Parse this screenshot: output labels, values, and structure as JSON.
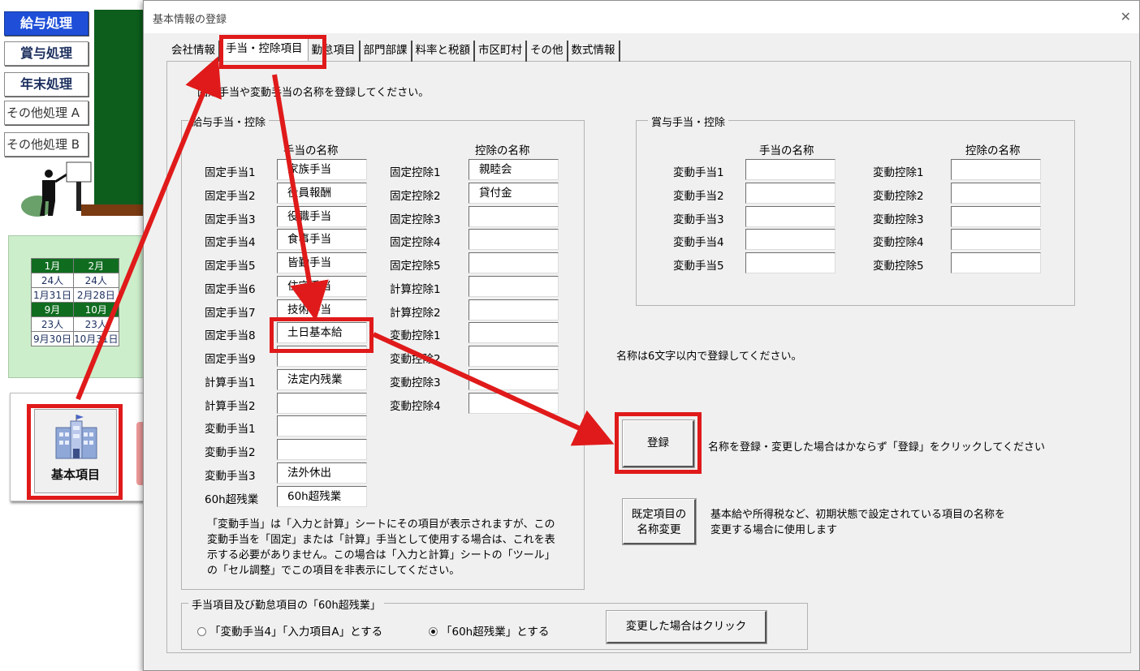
{
  "sheet": {
    "side_buttons": [
      "給与処理",
      "賞与処理",
      "年末処理",
      "その他処理 A",
      "その他処理 B"
    ],
    "calendar": [
      [
        "1月",
        "2月"
      ],
      [
        "24人",
        "24人"
      ],
      [
        "1月31日",
        "2月28日"
      ],
      [
        "9月",
        "10月"
      ],
      [
        "23人",
        "23人"
      ],
      [
        "9月30日",
        "10月31日"
      ]
    ],
    "kihon_label": "基本項目"
  },
  "dialog": {
    "title": "基本情報の登録",
    "close_glyph": "✕",
    "tabs": [
      {
        "label": "会社情報",
        "selected": false
      },
      {
        "label": "手当・控除項目",
        "selected": true
      },
      {
        "label": "勤怠項目",
        "selected": false
      },
      {
        "label": "部門部課",
        "selected": false
      },
      {
        "label": "料率と税額",
        "selected": false
      },
      {
        "label": "市区町村",
        "selected": false
      },
      {
        "label": "その他",
        "selected": false
      },
      {
        "label": "数式情報",
        "selected": false
      }
    ],
    "instruction": "固定手当や変動手当の名称を登録してください。",
    "kyuyo": {
      "legend": "給与手当・控除",
      "allowance_header": "手当の名称",
      "deduction_header": "控除の名称",
      "allowances": [
        {
          "label": "固定手当1",
          "value": "家族手当"
        },
        {
          "label": "固定手当2",
          "value": "役員報酬"
        },
        {
          "label": "固定手当3",
          "value": "役職手当"
        },
        {
          "label": "固定手当4",
          "value": "食事手当"
        },
        {
          "label": "固定手当5",
          "value": "皆勤手当"
        },
        {
          "label": "固定手当6",
          "value": "住宅手当"
        },
        {
          "label": "固定手当7",
          "value": "技術手当"
        },
        {
          "label": "固定手当8",
          "value": "土日基本給"
        },
        {
          "label": "固定手当9",
          "value": ""
        },
        {
          "label": "計算手当1",
          "value": "法定内残業"
        },
        {
          "label": "計算手当2",
          "value": ""
        },
        {
          "label": "変動手当1",
          "value": ""
        },
        {
          "label": "変動手当2",
          "value": ""
        },
        {
          "label": "変動手当3",
          "value": "法外休出"
        },
        {
          "label": "60h超残業",
          "value": "60h超残業"
        }
      ],
      "deductions": [
        {
          "label": "固定控除1",
          "value": "親睦会"
        },
        {
          "label": "固定控除2",
          "value": "貸付金"
        },
        {
          "label": "固定控除3",
          "value": ""
        },
        {
          "label": "固定控除4",
          "value": ""
        },
        {
          "label": "固定控除5",
          "value": ""
        },
        {
          "label": "計算控除1",
          "value": ""
        },
        {
          "label": "計算控除2",
          "value": ""
        },
        {
          "label": "変動控除1",
          "value": ""
        },
        {
          "label": "変動控除2",
          "value": ""
        },
        {
          "label": "変動控除3",
          "value": ""
        },
        {
          "label": "変動控除4",
          "value": ""
        }
      ],
      "note": "「変動手当」は「入力と計算」シートにその項目が表示されますが、この変動手当を「固定」または「計算」手当として使用する場合は、これを表示する必要がありません。この場合は「入力と計算」シートの「ツール」の「セル調整」でこの項目を非表示にしてください。"
    },
    "shoyo": {
      "legend": "賞与手当・控除",
      "allowance_header": "手当の名称",
      "deduction_header": "控除の名称",
      "allowances": [
        {
          "label": "変動手当1",
          "value": ""
        },
        {
          "label": "変動手当2",
          "value": ""
        },
        {
          "label": "変動手当3",
          "value": ""
        },
        {
          "label": "変動手当4",
          "value": ""
        },
        {
          "label": "変動手当5",
          "value": ""
        }
      ],
      "deductions": [
        {
          "label": "変動控除1",
          "value": ""
        },
        {
          "label": "変動控除2",
          "value": ""
        },
        {
          "label": "変動控除3",
          "value": ""
        },
        {
          "label": "変動控除4",
          "value": ""
        },
        {
          "label": "変動控除5",
          "value": ""
        }
      ]
    },
    "name_limit_note": "名称は6文字以内で登録してください。",
    "register_button": "登録",
    "register_note": "名称を登録・変更した場合はかならず「登録」をクリックしてください",
    "rename_button_line1": "既定項目の",
    "rename_button_line2": "名称変更",
    "rename_note_line1": "基本給や所得税など、初期状態で設定されている項目の名称を",
    "rename_note_line2": "変更する場合に使用します",
    "sixty_group": {
      "legend": "手当項目及び勤怠項目の「60h超残業」",
      "option1": "「変動手当4」「入力項目A」とする",
      "option2": "「60h超残業」とする",
      "selected_option": 2,
      "apply_button": "変更した場合はクリック"
    }
  }
}
